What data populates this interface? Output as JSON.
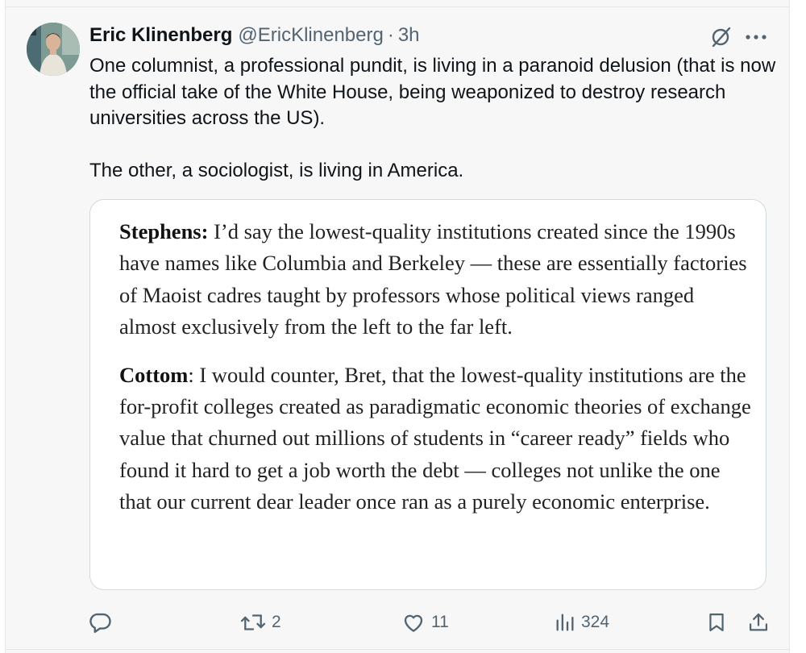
{
  "tweet": {
    "author_name": "Eric Klinenberg",
    "author_handle": "@EricKlinenberg",
    "separator": "·",
    "time": "3h",
    "text_paragraphs": [
      "One columnist, a professional pundit, is living in a paranoid delusion (that is now the official take of the White House, being weaponized to destroy research universities across the US).",
      "The other, a sociologist, is living in America."
    ]
  },
  "quote_image": {
    "blocks": [
      {
        "speaker": "Stephens:",
        "text": " I’d say the lowest-quality institutions created since the 1990s have names like Columbia and Berkeley — these are essentially factories of Maoist cadres taught by professors whose political views ranged almost exclusively from the left to the far left."
      },
      {
        "speaker": "Cottom",
        "text": ": I would counter, Bret, that the lowest-quality institutions are the for-profit colleges created as paradigmatic economic theories of exchange value that churned out millions of students in “career ready” fields who found it hard to get a job worth the debt — colleges not unlike the one that our current dear leader once ran as a purely economic enterprise."
      }
    ]
  },
  "actions": {
    "reply_count": "",
    "retweet_count": "2",
    "like_count": "11",
    "views_count": "324"
  },
  "icons": {
    "header": [
      "grok-icon",
      "more-icon"
    ],
    "actions": [
      "reply-icon",
      "retweet-icon",
      "like-icon",
      "views-icon",
      "bookmark-icon",
      "share-icon"
    ]
  },
  "colors": {
    "text_primary": "#0f1419",
    "text_secondary": "#536471",
    "card_border": "#cfd9de",
    "background": "#f7f7f8"
  }
}
